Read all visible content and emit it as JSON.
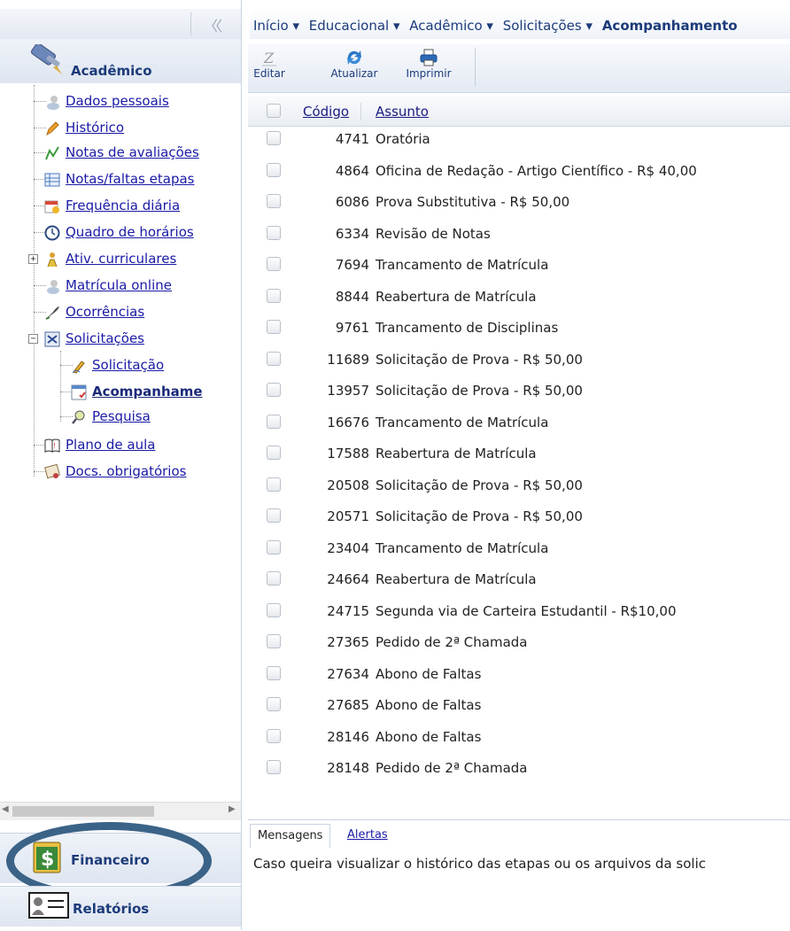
{
  "sidebar": {
    "collapse_label": "〈〈",
    "section_title": "Acadêmico",
    "items": [
      {
        "label": "Dados pessoais",
        "icon": "user-icon"
      },
      {
        "label": "Histórico",
        "icon": "pencil-icon"
      },
      {
        "label": "Notas de avaliações",
        "icon": "chart-icon"
      },
      {
        "label": "Notas/faltas etapas",
        "icon": "table-icon"
      },
      {
        "label": "Frequência diária",
        "icon": "calendar-icon"
      },
      {
        "label": "Quadro de horários",
        "icon": "clock-icon"
      },
      {
        "label": "Ativ. curriculares",
        "icon": "person-icon"
      },
      {
        "label": "Matrícula online",
        "icon": "user-icon"
      },
      {
        "label": "Ocorrências",
        "icon": "quill-icon"
      },
      {
        "label": "Solicitações",
        "icon": "forms-icon"
      },
      {
        "label": "Solicitação",
        "icon": "pen-icon"
      },
      {
        "label": "Acompanhame",
        "icon": "document-check-icon"
      },
      {
        "label": "Pesquisa",
        "icon": "magnifier-icon"
      },
      {
        "label": "Plano de aula",
        "icon": "book-icon"
      },
      {
        "label": "Docs. obrigatórios",
        "icon": "certificate-icon"
      }
    ],
    "financeiro_label": "Financeiro",
    "relatorios_label": "Relatórios"
  },
  "breadcrumb": {
    "items": [
      "Início ▾",
      "Educacional ▾",
      "Acadêmico ▾",
      "Solicitações ▾"
    ],
    "current": "Acompanhamento"
  },
  "toolbar": {
    "edit_label": "Editar",
    "refresh_label": "Atualizar",
    "print_label": "Imprimir"
  },
  "grid": {
    "header_code": "Código",
    "header_subject": "Assunto",
    "rows": [
      {
        "code": "4741",
        "subject": "Oratória"
      },
      {
        "code": "4864",
        "subject": "Oficina de Redação - Artigo Científico - R$ 40,00"
      },
      {
        "code": "6086",
        "subject": "Prova Substitutiva - R$ 50,00"
      },
      {
        "code": "6334",
        "subject": "Revisão de Notas"
      },
      {
        "code": "7694",
        "subject": "Trancamento de Matrícula"
      },
      {
        "code": "8844",
        "subject": "Reabertura de Matrícula"
      },
      {
        "code": "9761",
        "subject": "Trancamento de Disciplinas"
      },
      {
        "code": "11689",
        "subject": "Solicitação de Prova - R$ 50,00"
      },
      {
        "code": "13957",
        "subject": "Solicitação de Prova - R$ 50,00"
      },
      {
        "code": "16676",
        "subject": "Trancamento de Matrícula"
      },
      {
        "code": "17588",
        "subject": "Reabertura de Matrícula"
      },
      {
        "code": "20508",
        "subject": "Solicitação de Prova - R$ 50,00"
      },
      {
        "code": "20571",
        "subject": "Solicitação de Prova - R$ 50,00"
      },
      {
        "code": "23404",
        "subject": "Trancamento de Matrícula"
      },
      {
        "code": "24664",
        "subject": "Reabertura de Matrícula"
      },
      {
        "code": "24715",
        "subject": "Segunda via de Carteira Estudantil - R$10,00"
      },
      {
        "code": "27365",
        "subject": "Pedido de 2ª Chamada"
      },
      {
        "code": "27634",
        "subject": "Abono de Faltas"
      },
      {
        "code": "27685",
        "subject": "Abono de Faltas"
      },
      {
        "code": "28146",
        "subject": "Abono de Faltas"
      },
      {
        "code": "28148",
        "subject": "Pedido de 2ª Chamada"
      }
    ]
  },
  "messages": {
    "tab_messages": "Mensagens",
    "tab_alerts": "Alertas",
    "text": "Caso queira visualizar o histórico das etapas ou os arquivos da solic"
  },
  "colors": {
    "link": "#1a1aa6",
    "header_text": "#1c3b7a",
    "annotation_oval": "#3b6387"
  }
}
